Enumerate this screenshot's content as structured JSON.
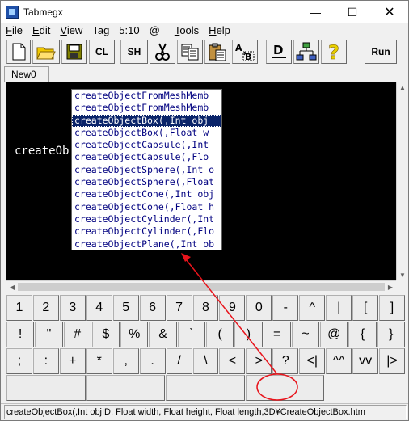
{
  "window": {
    "title": "Tabmegx"
  },
  "titlebar": {
    "minimize": "—",
    "maximize": "☐",
    "close": "✕"
  },
  "menu": [
    {
      "label": "File",
      "ul": "F"
    },
    {
      "label": "Edit",
      "ul": "E"
    },
    {
      "label": "View",
      "ul": "V"
    },
    {
      "label": "Tag",
      "ul": "T"
    },
    {
      "label": "5:10",
      "ul": ""
    },
    {
      "label": "@",
      "ul": ""
    },
    {
      "label": "Tools",
      "ul": "T"
    },
    {
      "label": "Help",
      "ul": "H"
    }
  ],
  "toolbar": {
    "cl_label": "CL",
    "sh_label": "SH",
    "run_label": "Run"
  },
  "tabs": [
    {
      "label": "New0"
    }
  ],
  "editor": {
    "text": "createOb"
  },
  "popup": {
    "items": [
      "createObjectFromMeshMemb",
      "createObjectFromMeshMemb",
      "createObjectBox(,Int obj",
      "createObjectBox(,Float w",
      "createObjectCapsule(,Int",
      "createObjectCapsule(,Flo",
      "createObjectSphere(,Int o",
      "createObjectSphere(,Float",
      "createObjectCone(,Int obj",
      "createObjectCone(,Float h",
      "createObjectCylinder(,Int",
      "createObjectCylinder(,Flo",
      "createObjectPlane(,Int ob"
    ],
    "selected_index": 2
  },
  "keypad": {
    "row1": [
      "1",
      "2",
      "3",
      "4",
      "5",
      "6",
      "7",
      "8",
      "9",
      "0",
      "-",
      "^",
      "|",
      "[",
      "]"
    ],
    "row2": [
      "!",
      "\"",
      "#",
      "$",
      "%",
      "&",
      "`",
      "(",
      ")",
      "=",
      "~",
      "@",
      "{",
      "}"
    ],
    "row3": [
      ";",
      ":",
      "+",
      "*",
      ",",
      ".",
      "/",
      "\\",
      "<",
      ">",
      "?",
      "<|",
      "^^",
      "vv",
      "|>"
    ],
    "row4": [
      "",
      "",
      "",
      ""
    ]
  },
  "statusbar": {
    "text": "createObjectBox(,Int objID, Float width, Float height, Float length,3D¥CreateObjectBox.htm"
  },
  "colors": {
    "editor_bg": "#000000",
    "selection_bg": "#0a246a",
    "annotation": "#e8141c"
  }
}
